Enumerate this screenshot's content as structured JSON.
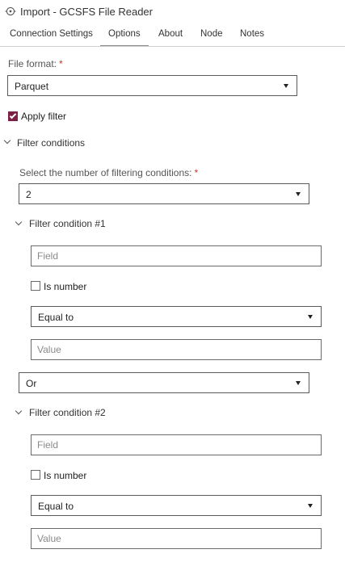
{
  "window": {
    "title": "Import - GCSFS File Reader",
    "icon": "import-target-icon"
  },
  "tabs": [
    {
      "label": "Connection Settings",
      "active": false
    },
    {
      "label": "Options",
      "active": true
    },
    {
      "label": "About",
      "active": false
    },
    {
      "label": "Node",
      "active": false
    },
    {
      "label": "Notes",
      "active": false
    }
  ],
  "file_format": {
    "label": "File format:",
    "required_mark": "*",
    "value": "Parquet"
  },
  "apply_filter": {
    "label": "Apply filter",
    "checked": true
  },
  "filter_conditions": {
    "title": "Filter conditions",
    "count_label": "Select the number of filtering conditions:",
    "required_mark": "*",
    "count_value": "2",
    "conditions": [
      {
        "title": "Filter condition #1",
        "field_placeholder": "Field",
        "is_number_label": "Is number",
        "is_number_checked": false,
        "operator": "Equal to",
        "value_placeholder": "Value"
      },
      {
        "title": "Filter condition #2",
        "field_placeholder": "Field",
        "is_number_label": "Is number",
        "is_number_checked": false,
        "operator": "Equal to",
        "value_placeholder": "Value"
      }
    ],
    "logical_operator": "Or"
  },
  "colors": {
    "checkbox_checked": "#7b2147",
    "required": "#c0392b"
  }
}
